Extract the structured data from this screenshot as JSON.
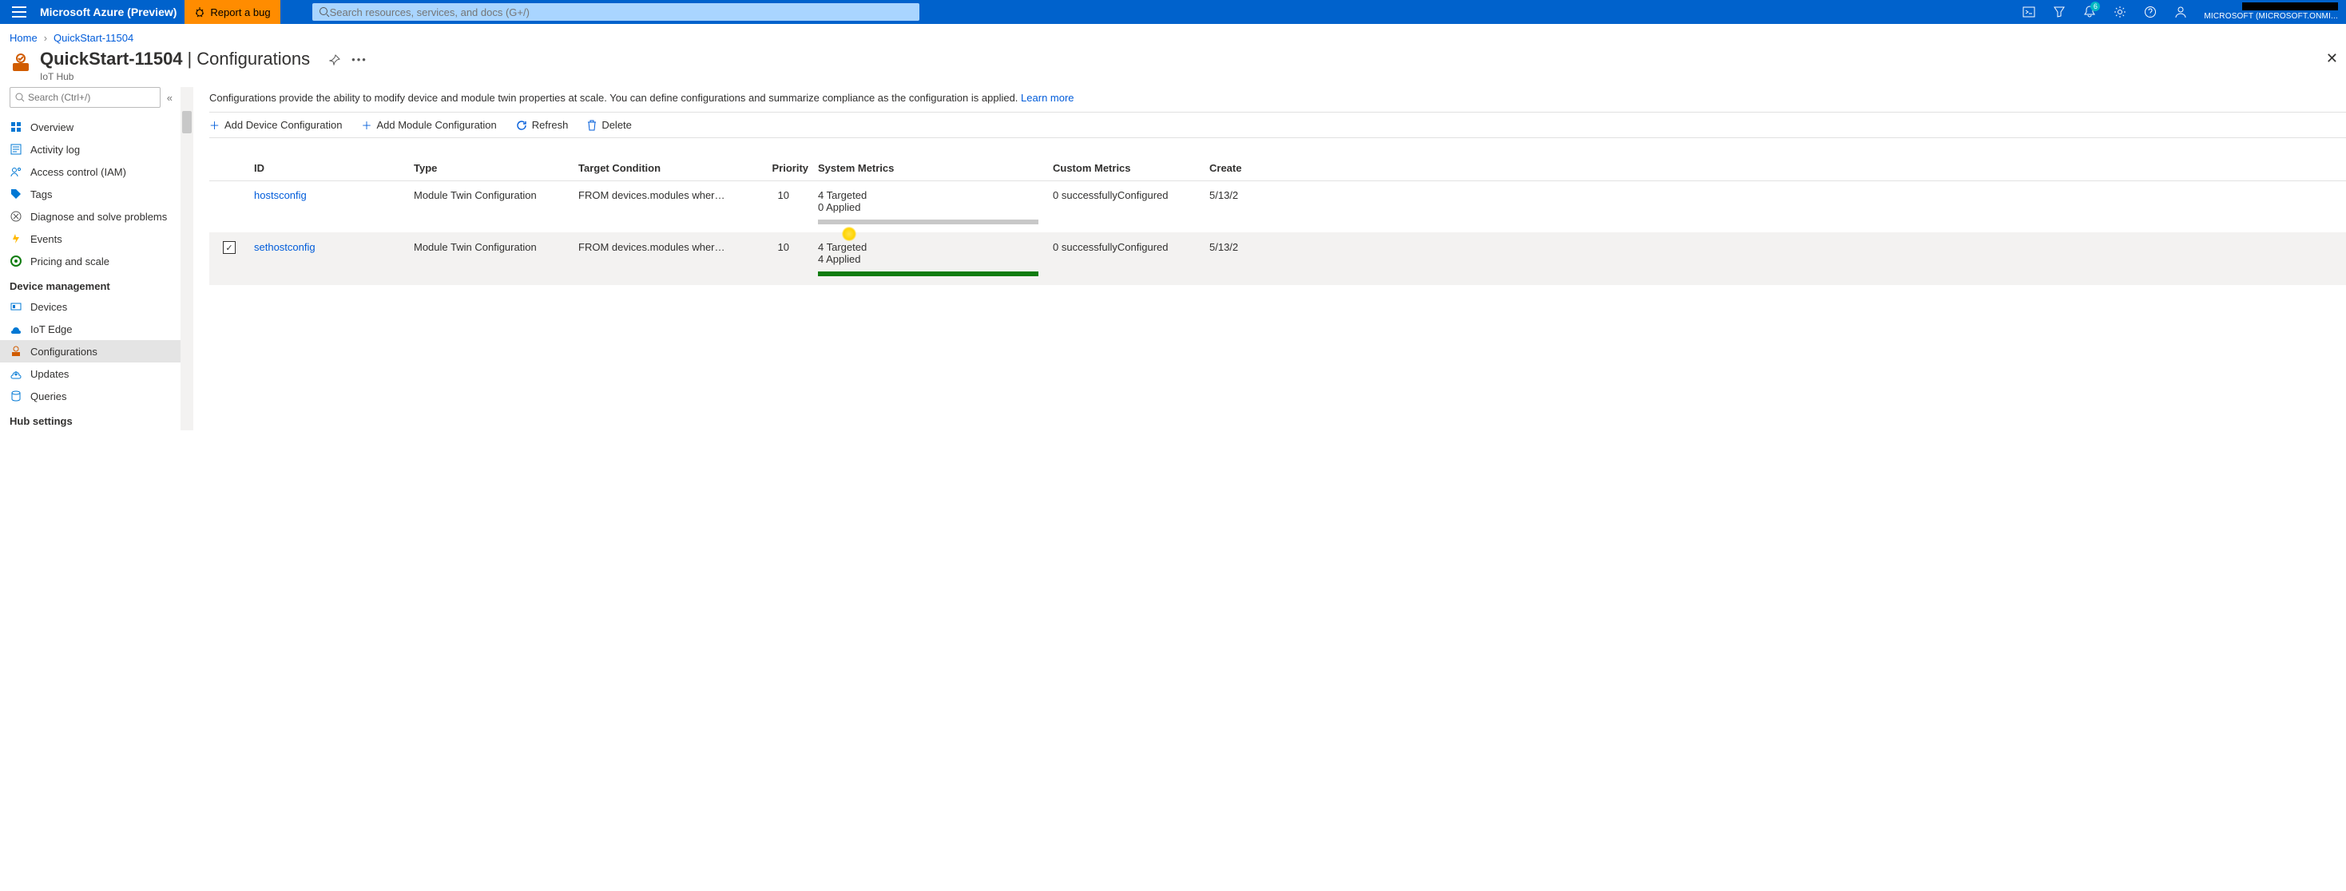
{
  "header": {
    "brand": "Microsoft Azure (Preview)",
    "report_bug": "Report a bug",
    "search_placeholder": "Search resources, services, and docs (G+/)",
    "notification_count": "6",
    "tenant": "MICROSOFT (MICROSOFT.ONMI..."
  },
  "breadcrumb": {
    "home": "Home",
    "resource": "QuickStart-11504"
  },
  "blade": {
    "title": "QuickStart-11504",
    "section": "Configurations",
    "subtitle": "IoT Hub"
  },
  "sidebar": {
    "search_placeholder": "Search (Ctrl+/)",
    "items": [
      "Overview",
      "Activity log",
      "Access control (IAM)",
      "Tags",
      "Diagnose and solve problems",
      "Events",
      "Pricing and scale"
    ],
    "group_device": "Device management",
    "device_items": [
      "Devices",
      "IoT Edge",
      "Configurations",
      "Updates",
      "Queries"
    ],
    "group_hub": "Hub settings"
  },
  "main": {
    "intro": "Configurations provide the ability to modify device and module twin properties at scale. You can define configurations and summarize compliance as the configuration is applied.",
    "learn_more": "Learn more",
    "toolbar": {
      "add_device": "Add Device Configuration",
      "add_module": "Add Module Configuration",
      "refresh": "Refresh",
      "delete": "Delete"
    },
    "columns": {
      "id": "ID",
      "type": "Type",
      "target": "Target Condition",
      "priority": "Priority",
      "system": "System Metrics",
      "custom": "Custom Metrics",
      "created": "Create"
    },
    "rows": [
      {
        "id": "hostsconfig",
        "type": "Module Twin Configuration",
        "target": "FROM devices.modules where m...",
        "priority": "10",
        "sys_line1": "4 Targeted",
        "sys_line2": "0 Applied",
        "progress_pct": 0,
        "custom": "0 successfullyConfigured",
        "created": "5/13/2",
        "checked": false
      },
      {
        "id": "sethostconfig",
        "type": "Module Twin Configuration",
        "target": "FROM devices.modules where m...",
        "priority": "10",
        "sys_line1": "4 Targeted",
        "sys_line2": "4 Applied",
        "progress_pct": 100,
        "custom": "0 successfullyConfigured",
        "created": "5/13/2",
        "checked": true
      }
    ]
  }
}
